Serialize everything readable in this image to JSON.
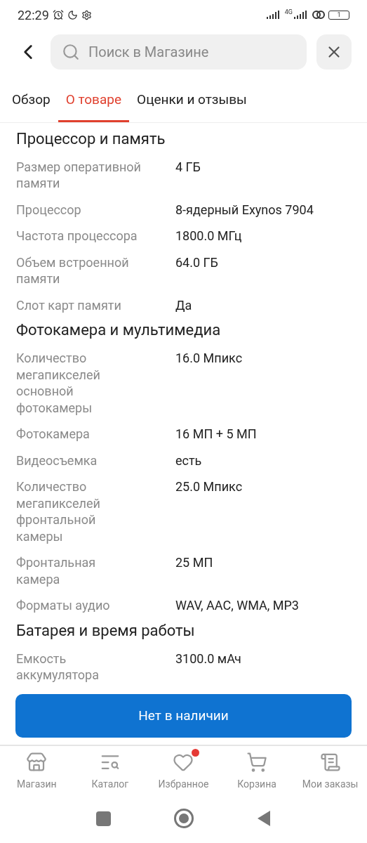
{
  "status_bar": {
    "time": "22:29",
    "network": "4G",
    "battery": "1"
  },
  "search": {
    "placeholder": "Поиск в Магазине"
  },
  "tabs": [
    {
      "label": "Обзор",
      "selected": false
    },
    {
      "label": "О товаре",
      "selected": true
    },
    {
      "label": "Оценки и отзывы",
      "selected": false
    }
  ],
  "sections": [
    {
      "title": "Процессор и память",
      "rows": [
        {
          "label": "Размер оперативной памяти",
          "value": "4 ГБ"
        },
        {
          "label": "Процессор",
          "value": "8-ядерный Exynos 7904"
        },
        {
          "label": "Частота процессора",
          "value": "1800.0 МГц"
        },
        {
          "label": "Объем встроенной памяти",
          "value": "64.0 ГБ"
        },
        {
          "label": "Слот карт памяти",
          "value": "Да"
        }
      ]
    },
    {
      "title": "Фотокамера и мультимедиа",
      "rows": [
        {
          "label": "Количество мегапикселей основной фотокамеры",
          "value": "16.0 Мпикс"
        },
        {
          "label": "Фотокамера",
          "value": "16 МП + 5 МП"
        },
        {
          "label": "Видеосъемка",
          "value": "есть"
        },
        {
          "label": "Количество мегапикселей фронтальной камеры",
          "value": "25.0 Мпикс"
        },
        {
          "label": "Фронтальная камера",
          "value": "25 МП"
        },
        {
          "label": "Форматы аудио",
          "value": "WAV, AAC, WMA, MP3"
        }
      ]
    },
    {
      "title": "Батарея и время работы",
      "rows": [
        {
          "label": "Емкость аккумулятора",
          "value": "3100.0 мАч"
        }
      ]
    }
  ],
  "action_button": "Нет в наличии",
  "bottom_nav": [
    {
      "kind": "store",
      "label": "Магазин",
      "badge": false
    },
    {
      "kind": "catalog",
      "label": "Каталог",
      "badge": false
    },
    {
      "kind": "heart",
      "label": "Избранное",
      "badge": true
    },
    {
      "kind": "cart",
      "label": "Корзина",
      "badge": false
    },
    {
      "kind": "orders",
      "label": "Мои заказы",
      "badge": false
    }
  ]
}
